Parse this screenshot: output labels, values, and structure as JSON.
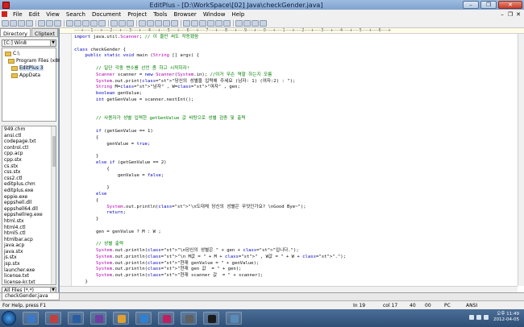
{
  "window": {
    "title": "EditPlus - [D:\\WorkSpace\\[02] Java\\checkGender.java]",
    "minimize": "–",
    "restore": "❐",
    "close": "✕"
  },
  "menu": [
    "File",
    "Edit",
    "View",
    "Search",
    "Document",
    "Project",
    "Tools",
    "Browser",
    "Window",
    "Help"
  ],
  "sidebar": {
    "tabs": [
      "Directory",
      "Cliptext"
    ],
    "drive": "[C:] Win8",
    "tree": [
      "C:\\",
      "Program Files (x86)",
      "EditPlus 3",
      "AppData"
    ],
    "files": [
      "949.chm",
      "ansi.ctl",
      "codepage.txt",
      "control.ctl",
      "cpp.acp",
      "cpp.stx",
      "cs.stx",
      "css.stx",
      "css2.ctl",
      "editplus.chm",
      "editplus.exe",
      "eppie.exe",
      "eppshell.dll",
      "eppshell64.dll",
      "eppshellreg.exe",
      "html.stx",
      "html4.ctl",
      "html5.ctl",
      "htmlbar.acp",
      "java.acp",
      "java.stx",
      "js.stx",
      "jsp.stx",
      "launcher.exe",
      "license.txt",
      "license-kr.txt"
    ],
    "filter": "All Files (*.*)"
  },
  "ruler": "----+----1----+----2----+----3----+----4----+----5----+----6----+----7----+----8----+----9----+----0----+----1----+----2----+----3----+----4----+----5----+----6----+",
  "code": [
    "import java.util.Scanner; // 이 줄만 써도 작동됐음",
    "",
    "class checkGender {",
    "    public static void main (String [] args) {",
    "",
    "        // 일단 각종 변수를 선언 좀 하고 시작하자!",
    "        Scanner scanner = new Scanner(System.in); //이거 무슨 역할 하는지 모름",
    "        System.out.print(\"당신의 성별을 입력해 주세요 (남자: 1) (여자:2) : \");",
    "        String M=\"남자\" , W=\"여자\" , gen;",
    "        boolean genValue;",
    "        int getGenValue = scanner.nextInt();",
    "",
    "",
    "        // 사용자가 성별 입력한 getGenValue 값 바탕으로 성별 검증 및 출력",
    "",
    "        if (getGenValue == 1)",
    "        {",
    "            genValue = true;",
    "",
    "        }",
    "        else if (getGenValue == 2)",
    "            {",
    "                genValue = false;",
    "",
    "            }",
    "        else",
    "        {",
    "            System.out.println(\"\\n도대체 당신의 성별은 무엇인가요? \\nGood Bye~\");",
    "            return;",
    "        }",
    "",
    "        gen = genValue ? M : W ;",
    "",
    "        // 성별 출력",
    "        System.out.println(\"\\n당신의 성별은 \" + gen + \"입니다.\");",
    "        System.out.println(\"\\n M값 = \" + M + \" , W값 = \" + W + \".\");",
    "        System.out.println(\"현재 genValue = \" + genValue);",
    "        System.out.println(\"현재 gen 값  = \" + gen);",
    "        System.out.println(\"현재 scanner 값  = \" + scanner);",
    "    }",
    "}"
  ],
  "doc_tab": "checkGender.java",
  "status": {
    "help": "For Help, press F1",
    "ln": "In 19",
    "col": "col 17",
    "n1": "40",
    "n2": "00",
    "pc": "PC",
    "enc": "ANSI"
  },
  "clock": {
    "time": "오후 11:49",
    "date": "2012-04-05"
  },
  "taskbar_colors": [
    "#3a78c8",
    "#c04040",
    "#2a5ca0",
    "#7040a0",
    "#e0a030",
    "#3080d0",
    "#c02060",
    "#606060",
    "#1a1a1a",
    "#5a8ab8"
  ]
}
